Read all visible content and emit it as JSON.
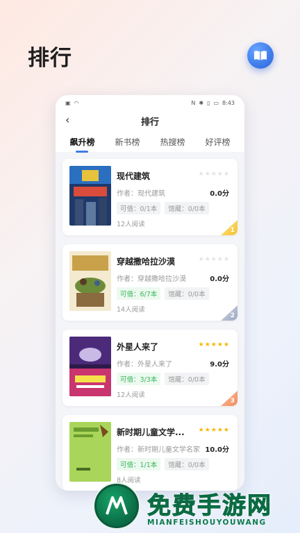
{
  "page": {
    "title": "排行"
  },
  "status_bar": {
    "time": "8:43"
  },
  "app_bar": {
    "back_icon": "chevron-left-icon",
    "title": "排行"
  },
  "tabs": [
    {
      "label": "飙升榜",
      "active": true
    },
    {
      "label": "新书榜",
      "active": false
    },
    {
      "label": "热搜榜",
      "active": false
    },
    {
      "label": "好评榜",
      "active": false
    }
  ],
  "books": [
    {
      "title": "现代建筑",
      "author": "作者：现代建筑",
      "score": "0.0分",
      "stars": 0,
      "borrowable": "可借：0/1本",
      "collection": "馆藏：0/0本",
      "readers": "12人阅读",
      "rank": "1"
    },
    {
      "title": "穿越撒哈拉沙漠",
      "author": "作者：穿越撒哈拉沙漠",
      "score": "0.0分",
      "stars": 0,
      "borrowable": "可借：6/7本",
      "collection": "馆藏：0/0本",
      "readers": "14人阅读",
      "rank": "2"
    },
    {
      "title": "外星人来了",
      "author": "作者：外星人来了",
      "score": "9.0分",
      "stars": 5,
      "borrowable": "可借：3/3本",
      "collection": "馆藏：0/0本",
      "readers": "12人阅读",
      "rank": "3"
    },
    {
      "title": "新时期儿童文学...",
      "author": "作者：新时期儿童文学名家...",
      "score": "10.0分",
      "stars": 5,
      "borrowable": "可借：1/1本",
      "collection": "馆藏：0/0本",
      "readers": "8人阅读",
      "rank": ""
    }
  ],
  "watermark": {
    "text": "免费手游网",
    "subtext": "MIANFEISHOUYOUWANG"
  },
  "colors": {
    "accent": "#3f7bea",
    "star": "#f5b800",
    "green_tag": "#3bb55d"
  }
}
